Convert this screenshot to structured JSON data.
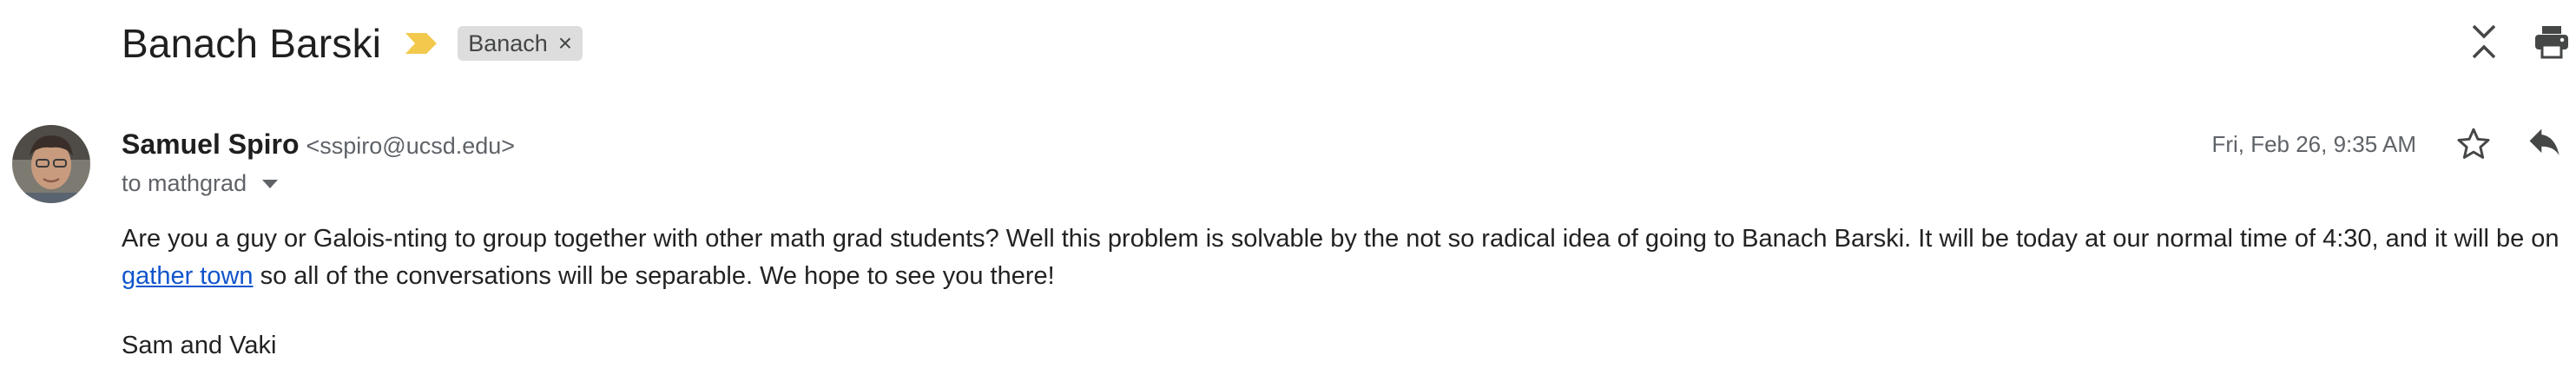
{
  "subject": "Banach Barski",
  "label": {
    "name": "Banach",
    "remove_glyph": "×"
  },
  "sender": {
    "name": "Samuel Spiro",
    "email": "<sspiro@ucsd.edu>"
  },
  "recipient": "to mathgrad",
  "timestamp": "Fri, Feb 26, 9:35 AM",
  "body": {
    "paragraph_start": "Are you a guy or Galois-nting to group together with other math grad students?  Well this problem is solvable by the not so radical idea of going to Banach Barski.  It will be today at our normal time of 4:30, and it will be on",
    "link_text": " gather town",
    "paragraph_end": " so all of the conversations will be separable.  We hope to see you there!",
    "signature": "Sam and Vaki"
  },
  "icons": {
    "importance": "importance-marker-icon",
    "collapse": "collapse-all-icon",
    "print": "print-icon",
    "star": "star-icon",
    "reply": "reply-icon",
    "expand": "chevron-down-icon"
  },
  "colors": {
    "importance": "#f2c94c",
    "chip_bg": "#dddddd",
    "link": "#1155cc",
    "secondary_text": "#5f6368"
  }
}
